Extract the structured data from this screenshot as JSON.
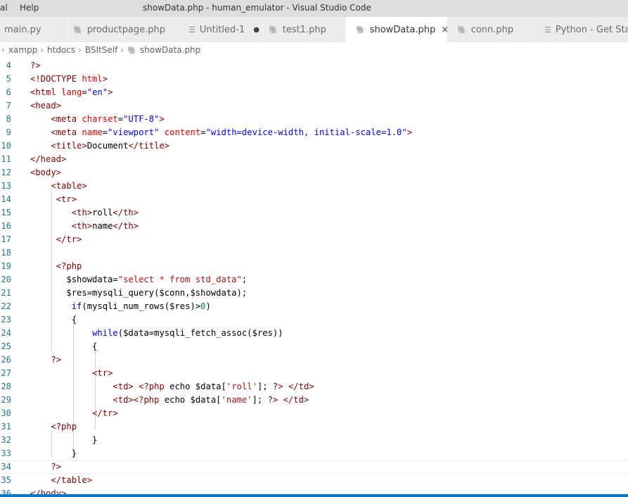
{
  "window": {
    "menu": [
      "al",
      "Help"
    ],
    "title": "showData.php - human_emulator - Visual Studio Code"
  },
  "tabs": [
    {
      "label": "main.py",
      "icon": "python-icon",
      "state": "normal"
    },
    {
      "label": "productpage.php",
      "icon": "php-icon",
      "state": "normal"
    },
    {
      "label": "Untitled-1",
      "icon": "text-file-icon",
      "state": "unsaved"
    },
    {
      "label": "test1.php",
      "icon": "php-icon",
      "state": "normal"
    },
    {
      "label": "showData.php",
      "icon": "php-icon",
      "state": "active"
    },
    {
      "label": "conn.php",
      "icon": "php-icon",
      "state": "normal"
    },
    {
      "label": "Python - Get Started",
      "icon": "text-file-icon",
      "state": "normal"
    }
  ],
  "glyphs": {
    "close": "×",
    "dirty": "●",
    "chevron": "›",
    "php": "🐘",
    "file": "☰"
  },
  "breadcrumb": [
    "xampp",
    "htdocs",
    "BSItSelf",
    "showData.php"
  ],
  "colors": {
    "php_icon": "#9b5fc8",
    "line_number": "#237893",
    "status_bar": "#007acc"
  },
  "editor": {
    "active_line": 34,
    "lines": [
      {
        "n": "4",
        "toks": [
          [
            "t-php",
            "?>"
          ]
        ]
      },
      {
        "n": "5",
        "toks": [
          [
            "t-tag",
            "<!DOCTYPE "
          ],
          [
            "t-attr",
            "html"
          ],
          [
            "t-tag",
            ">"
          ]
        ]
      },
      {
        "n": "6",
        "toks": [
          [
            "t-tag",
            "<html "
          ],
          [
            "t-attr",
            "lang"
          ],
          [
            "t-plain",
            "="
          ],
          [
            "t-str",
            "\"en\""
          ],
          [
            "t-tag",
            ">"
          ]
        ]
      },
      {
        "n": "7",
        "toks": [
          [
            "t-tag",
            "<head>"
          ]
        ]
      },
      {
        "n": "8",
        "toks": [
          [
            "t-plain",
            "    "
          ],
          [
            "t-tag",
            "<meta "
          ],
          [
            "t-attr",
            "charset"
          ],
          [
            "t-plain",
            "="
          ],
          [
            "t-str",
            "\"UTF-8\""
          ],
          [
            "t-tag",
            ">"
          ]
        ]
      },
      {
        "n": "9",
        "toks": [
          [
            "t-plain",
            "    "
          ],
          [
            "t-tag",
            "<meta "
          ],
          [
            "t-attr",
            "name"
          ],
          [
            "t-plain",
            "="
          ],
          [
            "t-str",
            "\"viewport\""
          ],
          [
            "t-plain",
            " "
          ],
          [
            "t-attr",
            "content"
          ],
          [
            "t-plain",
            "="
          ],
          [
            "t-str",
            "\"width=device-width, initial-scale=1.0\""
          ],
          [
            "t-tag",
            ">"
          ]
        ]
      },
      {
        "n": "10",
        "toks": [
          [
            "t-plain",
            "    "
          ],
          [
            "t-tag",
            "<title>"
          ],
          [
            "t-plain",
            "Document"
          ],
          [
            "t-tag",
            "</title>"
          ]
        ]
      },
      {
        "n": "11",
        "toks": [
          [
            "t-tag",
            "</head>"
          ]
        ]
      },
      {
        "n": "12",
        "toks": [
          [
            "t-tag",
            "<body>"
          ]
        ]
      },
      {
        "n": "13",
        "toks": [
          [
            "t-plain",
            "    "
          ],
          [
            "t-tag",
            "<table>"
          ]
        ]
      },
      {
        "n": "14",
        "toks": [
          [
            "t-plain",
            "     "
          ],
          [
            "t-tag",
            "<tr>"
          ]
        ]
      },
      {
        "n": "15",
        "toks": [
          [
            "t-plain",
            "        "
          ],
          [
            "t-tag",
            "<th>"
          ],
          [
            "t-plain",
            "roll"
          ],
          [
            "t-tag",
            "</th>"
          ]
        ]
      },
      {
        "n": "16",
        "toks": [
          [
            "t-plain",
            "        "
          ],
          [
            "t-tag",
            "<th>"
          ],
          [
            "t-plain",
            "name"
          ],
          [
            "t-tag",
            "</th>"
          ]
        ]
      },
      {
        "n": "17",
        "toks": [
          [
            "t-plain",
            "     "
          ],
          [
            "t-tag",
            "</tr>"
          ]
        ]
      },
      {
        "n": "18",
        "toks": []
      },
      {
        "n": "19",
        "toks": [
          [
            "t-plain",
            "     "
          ],
          [
            "t-php",
            "<?php"
          ]
        ]
      },
      {
        "n": "20",
        "toks": [
          [
            "t-plain",
            "       $showdata="
          ],
          [
            "t-sq",
            "\"select * from std_data\""
          ],
          [
            "t-plain",
            ";"
          ]
        ]
      },
      {
        "n": "21",
        "toks": [
          [
            "t-plain",
            "       $res=mysqli_query($conn,$showdata);"
          ]
        ]
      },
      {
        "n": "22",
        "toks": [
          [
            "t-plain",
            "        "
          ],
          [
            "t-kw",
            "if"
          ],
          [
            "t-plain",
            "(mysqli_num_rows($res)>"
          ],
          [
            "t-num",
            "0"
          ],
          [
            "t-plain",
            ")"
          ]
        ]
      },
      {
        "n": "23",
        "toks": [
          [
            "t-plain",
            "        {"
          ]
        ]
      },
      {
        "n": "24",
        "toks": [
          [
            "t-plain",
            "            "
          ],
          [
            "t-kw",
            "while"
          ],
          [
            "t-plain",
            "($data=mysqli_fetch_assoc($res))"
          ]
        ]
      },
      {
        "n": "25",
        "toks": [
          [
            "t-plain",
            "            {"
          ]
        ]
      },
      {
        "n": "26",
        "toks": [
          [
            "t-plain",
            "    "
          ],
          [
            "t-php",
            "?>"
          ]
        ]
      },
      {
        "n": "27",
        "toks": [
          [
            "t-plain",
            "            "
          ],
          [
            "t-tag",
            "<tr>"
          ]
        ]
      },
      {
        "n": "28",
        "toks": [
          [
            "t-plain",
            "                "
          ],
          [
            "t-tag",
            "<td>"
          ],
          [
            "t-plain",
            " "
          ],
          [
            "t-php",
            "<?php"
          ],
          [
            "t-plain",
            " echo $data["
          ],
          [
            "t-sq",
            "'roll'"
          ],
          [
            "t-plain",
            "]; "
          ],
          [
            "t-php",
            "?>"
          ],
          [
            "t-plain",
            " "
          ],
          [
            "t-tag",
            "</td>"
          ]
        ]
      },
      {
        "n": "29",
        "toks": [
          [
            "t-plain",
            "                "
          ],
          [
            "t-tag",
            "<td>"
          ],
          [
            "t-php",
            "<?php"
          ],
          [
            "t-plain",
            " echo $data["
          ],
          [
            "t-sq",
            "'name'"
          ],
          [
            "t-plain",
            "]; "
          ],
          [
            "t-php",
            "?>"
          ],
          [
            "t-plain",
            " "
          ],
          [
            "t-tag",
            "</td>"
          ]
        ]
      },
      {
        "n": "30",
        "toks": [
          [
            "t-plain",
            "            "
          ],
          [
            "t-tag",
            "</tr>"
          ]
        ]
      },
      {
        "n": "31",
        "toks": [
          [
            "t-plain",
            "    "
          ],
          [
            "t-php",
            "<?php"
          ]
        ]
      },
      {
        "n": "32",
        "toks": [
          [
            "t-plain",
            "            }"
          ]
        ]
      },
      {
        "n": "33",
        "toks": [
          [
            "t-plain",
            "        }"
          ]
        ]
      },
      {
        "n": "34",
        "toks": [
          [
            "t-plain",
            "    "
          ],
          [
            "t-php",
            "?>"
          ]
        ]
      },
      {
        "n": "35",
        "toks": [
          [
            "t-plain",
            "    "
          ],
          [
            "t-tag",
            "</table>"
          ]
        ]
      },
      {
        "n": "36",
        "toks": [
          [
            "t-tag",
            "</body>"
          ]
        ]
      }
    ]
  }
}
